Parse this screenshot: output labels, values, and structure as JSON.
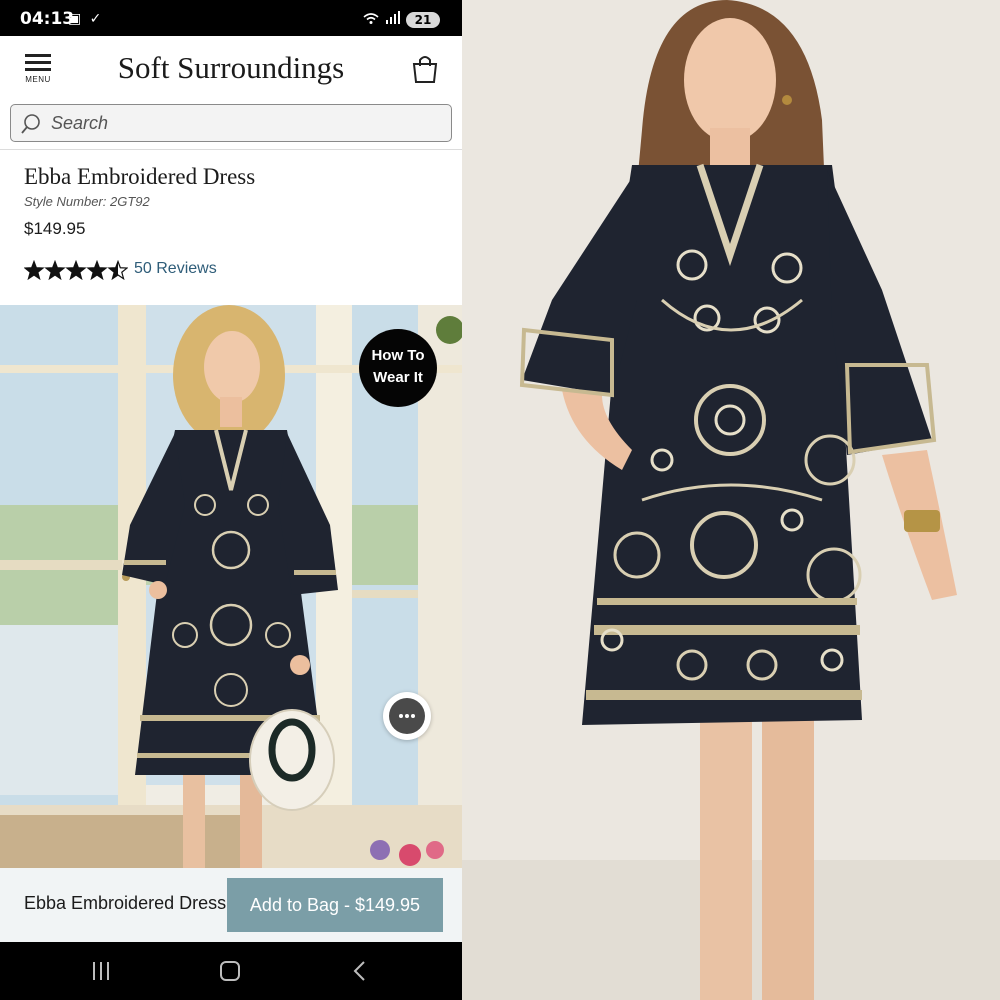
{
  "status_bar": {
    "time": "04:13",
    "battery": "21"
  },
  "header": {
    "menu_label": "MENU",
    "brand": "Soft Surroundings"
  },
  "search": {
    "placeholder": "Search"
  },
  "product": {
    "title": "Ebba Embroidered Dress",
    "style_label": "Style Number:",
    "style_number": "2GT92",
    "price": "$149.95",
    "rating": 4.5,
    "rating_max": 5,
    "reviews_label": "50 Reviews"
  },
  "hero": {
    "how_to_line1": "How To",
    "how_to_line2": "Wear It"
  },
  "sticky_bar": {
    "product_name": "Ebba Embroidered Dress",
    "button_label": "Add to Bag - $149.95"
  },
  "colors": {
    "accent_button": "#7b9ea7",
    "link": "#2f5d79",
    "dress": "#1f2430",
    "embroidery": "#d9cfb2"
  }
}
